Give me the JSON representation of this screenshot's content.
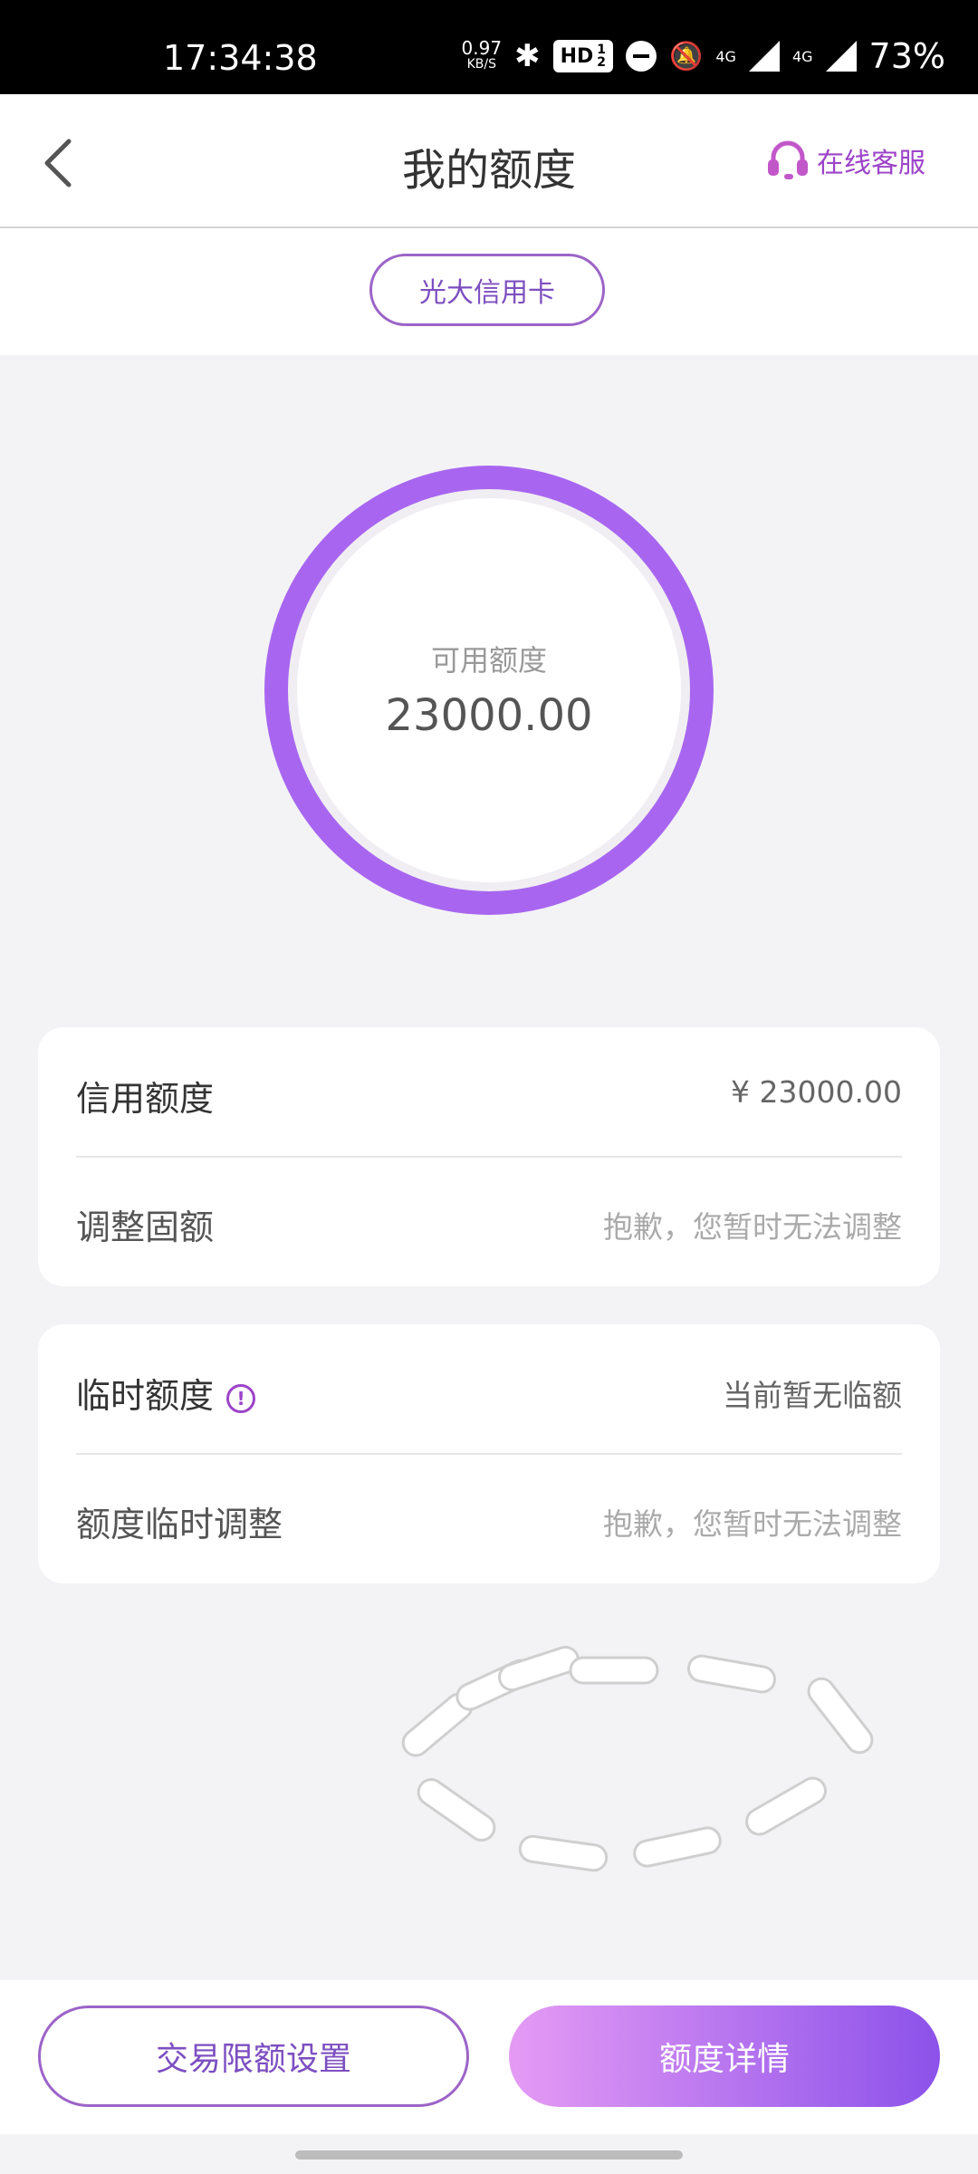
{
  "status_bar": {
    "time": "17:34:38",
    "net_speed_value": "0.97",
    "net_speed_unit": "KB/S",
    "hd_label": "HD",
    "hd_sim_top": "1",
    "hd_sim_bottom": "2",
    "network_1": "4G",
    "network_2": "4G",
    "battery": "73%"
  },
  "header": {
    "title": "我的额度",
    "support_label": "在线客服",
    "accent_color": "#9c43c9"
  },
  "card_selector": {
    "label": "光大信用卡"
  },
  "summary": {
    "label": "可用额度",
    "value": "23000.00",
    "ring_color": "#a866f0"
  },
  "credit_panel": {
    "row1_label": "信用额度",
    "row1_value": "¥ 23000.00",
    "row2_label": "调整固额",
    "row2_value": "抱歉，您暂时无法调整"
  },
  "temp_panel": {
    "row1_label": "临时额度",
    "row1_value": "当前暂无临额",
    "row2_label": "额度临时调整",
    "row2_value": "抱歉，您暂时无法调整"
  },
  "footer": {
    "left_button": "交易限额设置",
    "right_button": "额度详情"
  }
}
